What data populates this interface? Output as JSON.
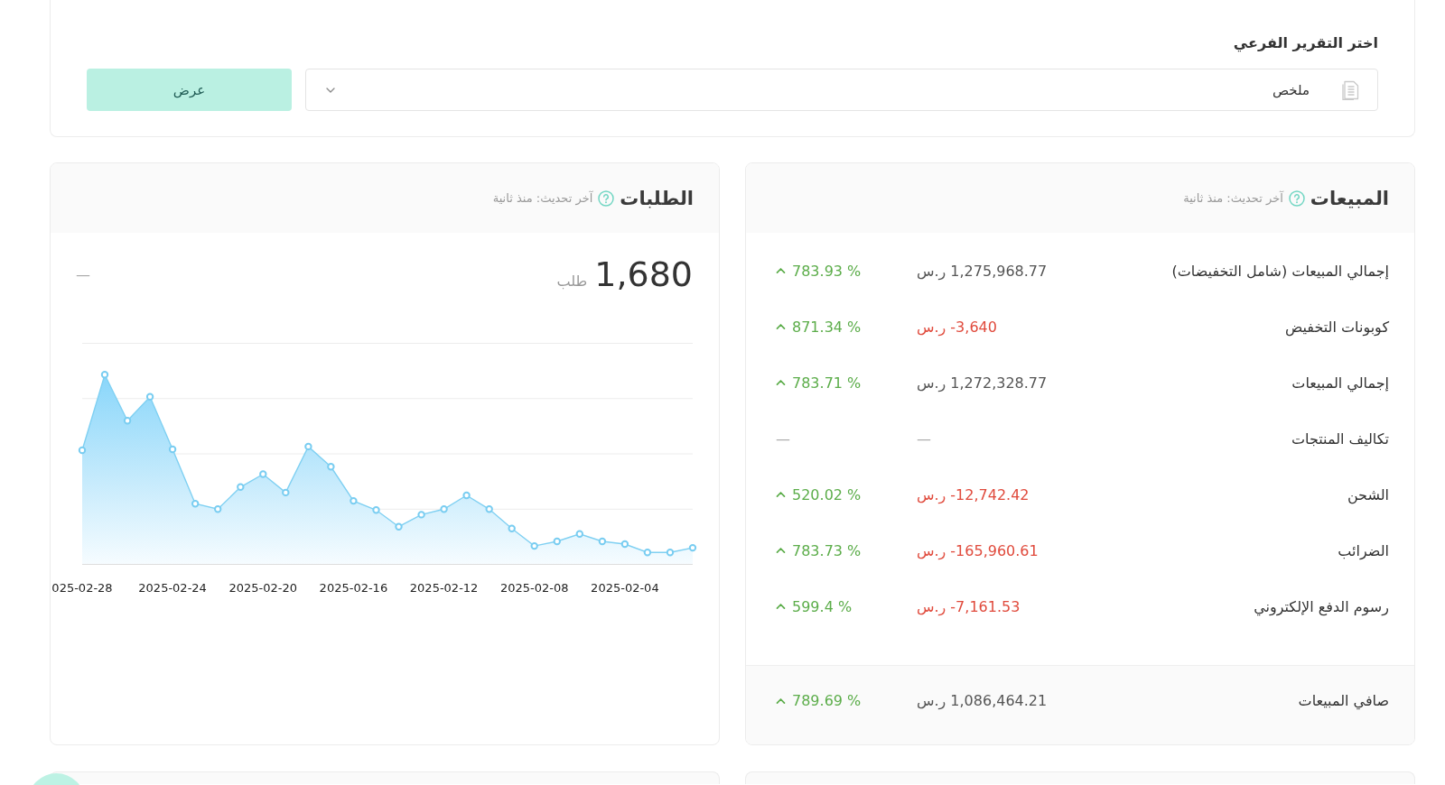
{
  "report_picker": {
    "label": "اختر التقرير الفرعي",
    "select": {
      "value": "ملخص"
    },
    "button": "عرض"
  },
  "sales": {
    "title": "المبيعات",
    "updated": "آخر تحديث: منذ ثانية",
    "rows": [
      {
        "kind": "amount",
        "label": "إجمالي المبيعات (شامل التخفيضات)",
        "amount": "1,275,968.77",
        "currency": "ر.س",
        "negative": false,
        "change": "783.93 %",
        "rising": true
      },
      {
        "kind": "amount",
        "label": "كوبونات التخفيض",
        "amount": "-3,640",
        "currency": "ر.س",
        "negative": true,
        "change": "871.34 %",
        "rising": true
      },
      {
        "kind": "amount",
        "label": "إجمالي المبيعات",
        "amount": "1,272,328.77",
        "currency": "ر.س",
        "negative": false,
        "change": "783.71 %",
        "rising": true
      },
      {
        "kind": "empty",
        "label": "تكاليف المنتجات",
        "amount": "—",
        "change": "—"
      },
      {
        "kind": "amount",
        "label": "الشحن",
        "amount": "-12,742.42",
        "currency": "ر.س",
        "negative": true,
        "change": "520.02 %",
        "rising": true
      },
      {
        "kind": "amount",
        "label": "الضرائب",
        "amount": "-165,960.61",
        "currency": "ر.س",
        "negative": true,
        "change": "783.73 %",
        "rising": true
      },
      {
        "kind": "amount",
        "label": "رسوم الدفع الإلكتروني",
        "amount": "-7,161.53",
        "currency": "ر.س",
        "negative": true,
        "change": "599.4 %",
        "rising": true
      }
    ],
    "total": {
      "kind": "amount",
      "label": "صافي المبيعات",
      "amount": "1,086,464.21",
      "currency": "ر.س",
      "negative": false,
      "change": "789.69 %",
      "rising": true
    }
  },
  "orders": {
    "title": "الطلبات",
    "updated": "آخر تحديث: منذ ثانية",
    "total": "1,680",
    "unit": "طلب",
    "change": "—",
    "chart": {
      "x_labels": [
        "2025-02-04",
        "2025-02-08",
        "2025-02-12",
        "2025-02-16",
        "2025-02-20",
        "2025-02-24",
        "025-02-28"
      ]
    }
  }
}
